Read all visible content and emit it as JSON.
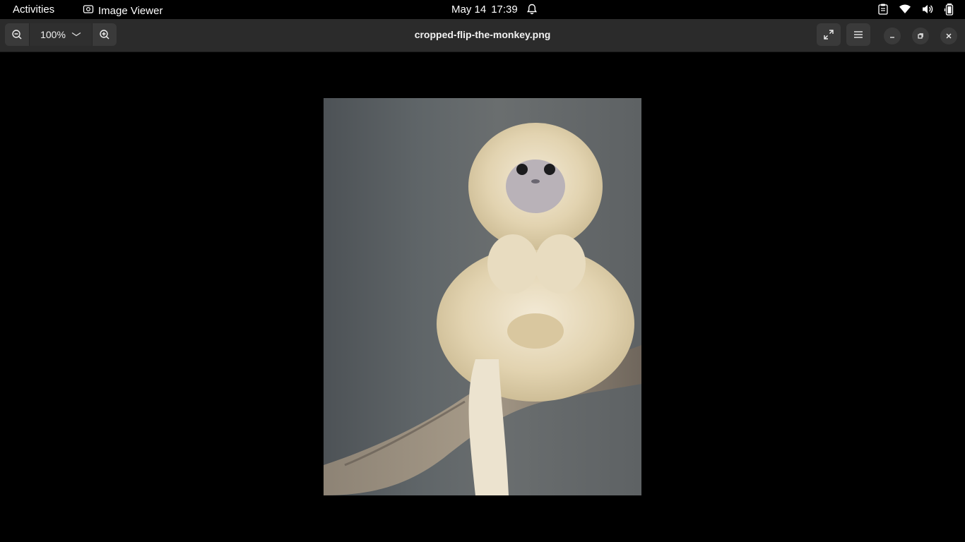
{
  "topbar": {
    "activities": "Activities",
    "app_name": "Image Viewer",
    "date": "May 14",
    "time": "17:39"
  },
  "header": {
    "zoom_value": "100%",
    "title": "cropped-flip-the-monkey.png"
  },
  "image": {
    "alt": "Photo of a fluffy golden snub-nosed monkey sitting on a tree branch"
  }
}
